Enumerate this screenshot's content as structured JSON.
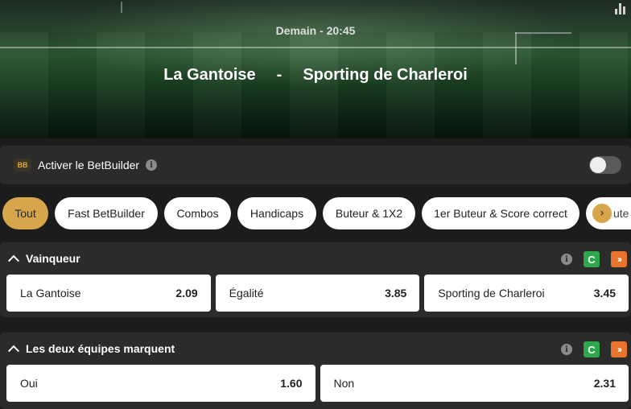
{
  "match": {
    "datetime": "Demain - 20:45",
    "home": "La Gantoise",
    "separator": "-",
    "away": "Sporting de Charleroi"
  },
  "betbuilder": {
    "badge": "BB",
    "label": "Activer le BetBuilder",
    "info": "i",
    "enabled": false
  },
  "filters": [
    {
      "label": "Tout",
      "active": true
    },
    {
      "label": "Fast BetBuilder"
    },
    {
      "label": "Combos"
    },
    {
      "label": "Handicaps"
    },
    {
      "label": "Buteur & 1X2"
    },
    {
      "label": "1er Buteur & Score correct"
    },
    {
      "label": "ute"
    }
  ],
  "filter_scroll_arrow": "›",
  "markets": [
    {
      "title": "Vainqueur",
      "info": "i",
      "cashout": "C",
      "boost": "››",
      "odds": [
        {
          "label": "La Gantoise",
          "price": "2.09"
        },
        {
          "label": "Égalité",
          "price": "3.85"
        },
        {
          "label": "Sporting de Charleroi",
          "price": "3.45"
        }
      ]
    },
    {
      "title": "Les deux équipes marquent",
      "info": "i",
      "cashout": "C",
      "boost": "››",
      "odds": [
        {
          "label": "Oui",
          "price": "1.60"
        },
        {
          "label": "Non",
          "price": "2.31"
        }
      ]
    }
  ],
  "colors": {
    "accent": "#d7a54a",
    "panel": "#2b2b2b",
    "cashout": "#2ea84a",
    "boost": "#e8742c"
  }
}
